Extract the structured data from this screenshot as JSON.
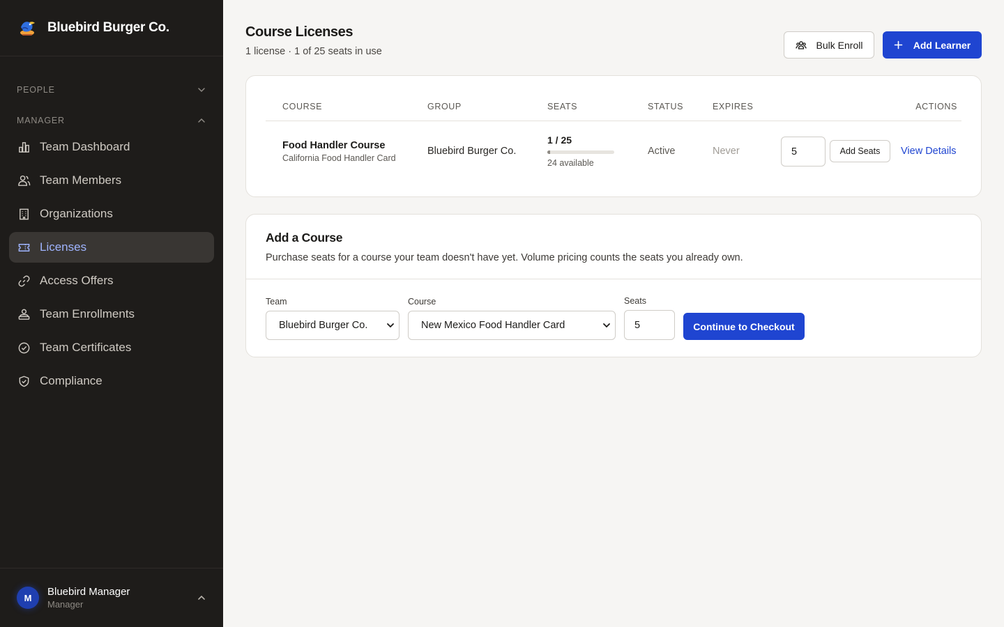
{
  "brand": {
    "name": "Bluebird Burger Co."
  },
  "sidebar": {
    "sections": [
      {
        "label": "PEOPLE",
        "expanded": false
      },
      {
        "label": "MANAGER",
        "expanded": true
      }
    ],
    "items": [
      {
        "label": "Team Dashboard",
        "icon": "bar-chart-icon"
      },
      {
        "label": "Team Members",
        "icon": "users-icon"
      },
      {
        "label": "Organizations",
        "icon": "building-icon"
      },
      {
        "label": "Licenses",
        "icon": "ticket-icon",
        "active": true
      },
      {
        "label": "Access Offers",
        "icon": "link-icon"
      },
      {
        "label": "Team Enrollments",
        "icon": "enrollment-icon"
      },
      {
        "label": "Team Certificates",
        "icon": "check-circle-icon"
      },
      {
        "label": "Compliance",
        "icon": "shield-check-icon"
      }
    ]
  },
  "user": {
    "initial": "M",
    "name": "Bluebird Manager",
    "role": "Manager"
  },
  "header": {
    "title": "Course Licenses",
    "subtitle": "1 license · 1 of 25 seats in use",
    "bulk_enroll_label": "Bulk Enroll",
    "add_learner_label": "Add Learner"
  },
  "licenses_table": {
    "columns": [
      "COURSE",
      "GROUP",
      "SEATS",
      "STATUS",
      "EXPIRES",
      "ACTIONS"
    ],
    "rows": [
      {
        "course": "Food Handler Course",
        "course_sub": "California Food Handler Card",
        "group": "Bluebird Burger Co.",
        "seats_text": "1 / 25",
        "seats_used": 1,
        "seats_total": 25,
        "seats_available": "24 available",
        "status": "Active",
        "expires": "Never",
        "add_seats_value": "5",
        "add_seats_label": "Add Seats",
        "view_details_label": "View Details"
      }
    ]
  },
  "add_course": {
    "title": "Add a Course",
    "description": "Purchase seats for a course your team doesn't have yet. Volume pricing counts the seats you already own.",
    "team_label": "Team",
    "team_value": "Bluebird Burger Co.",
    "course_label": "Course",
    "course_value": "New Mexico Food Handler Card",
    "seats_label": "Seats",
    "seats_value": "5",
    "checkout_label": "Continue to Checkout"
  },
  "colors": {
    "sidebar_bg": "#1e1c1a",
    "accent": "#1f45d1",
    "active_nav_text": "#9fb4ff",
    "page_bg": "#f6f5f3"
  }
}
